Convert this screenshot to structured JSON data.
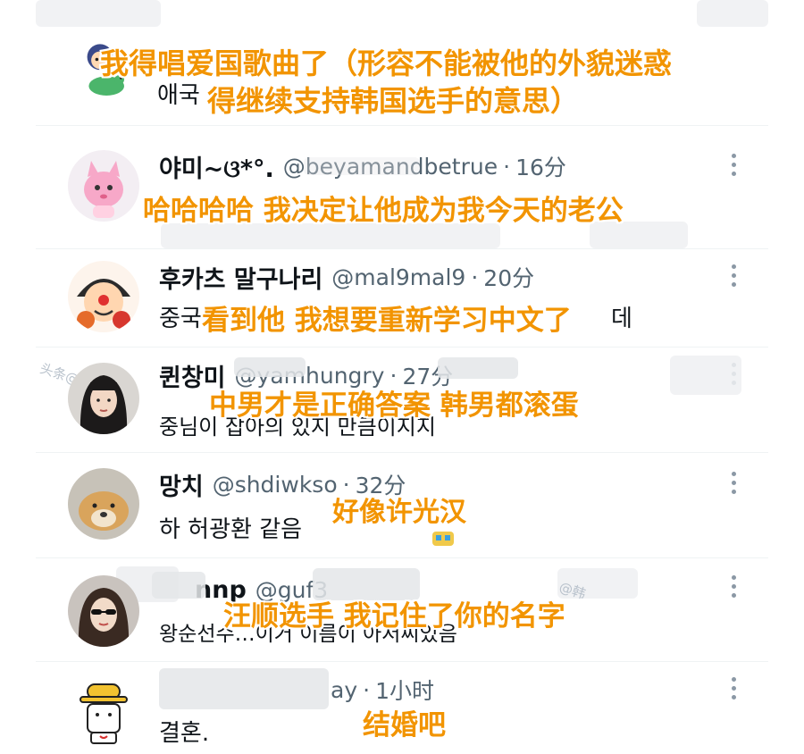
{
  "colors": {
    "caption": "#f29400",
    "name": "#0f1419",
    "meta": "#536471",
    "divider": "#eff3f4"
  },
  "captions": {
    "c1_line1": "我得唱爱国歌曲了（形容不能被他的外貌迷惑",
    "c1_line2": "得继续支持韩国选手的意思）",
    "c2": "哈哈哈哈 我决定让他成为我今天的老公",
    "c3": "看到他 我想要重新学习中文了",
    "c4": "中男才是正确答案 韩男都滚蛋",
    "c5": "好像许光汉",
    "c6": "汪顺选手 我记住了你的名字",
    "c7": "结婚吧"
  },
  "tweets": [
    {
      "name": "",
      "handle": "",
      "time": "",
      "text": "애국",
      "avatar": "cartoon-dino-avatar"
    },
    {
      "name": "야미~ଓ*°.",
      "handle": "@beyamandbetrue",
      "time": "16分",
      "text": "",
      "avatar": "pink-cat-avatar"
    },
    {
      "name": "후카츠 말구나리",
      "handle": "@mal9mal9",
      "time": "20分",
      "text": "중국",
      "text_end": "데",
      "avatar": "clown-face-avatar"
    },
    {
      "name": "퀸창미",
      "handle": "@yamhungry",
      "time": "27分",
      "text": "중님이 잡아의 있지 만큼이지지",
      "avatar": "girl-photo-avatar"
    },
    {
      "name": "망치",
      "handle": "@shdiwkso",
      "time": "32分",
      "text": "하 허광환 같음",
      "avatar": "dog-photo-avatar"
    },
    {
      "name": "nnp",
      "handle": "@guf3",
      "time": "",
      "text": "왕순선수…이거 이름이 아저씨있음",
      "avatar": "girl-sunglasses-avatar"
    },
    {
      "name": "",
      "handle": "ay",
      "time": "1小时",
      "text": "결혼.",
      "avatar": "sticker-hat-avatar"
    }
  ],
  "dot_separator": "·",
  "watermarks": {
    "w1": "头条@韩",
    "w2": "@韩"
  }
}
